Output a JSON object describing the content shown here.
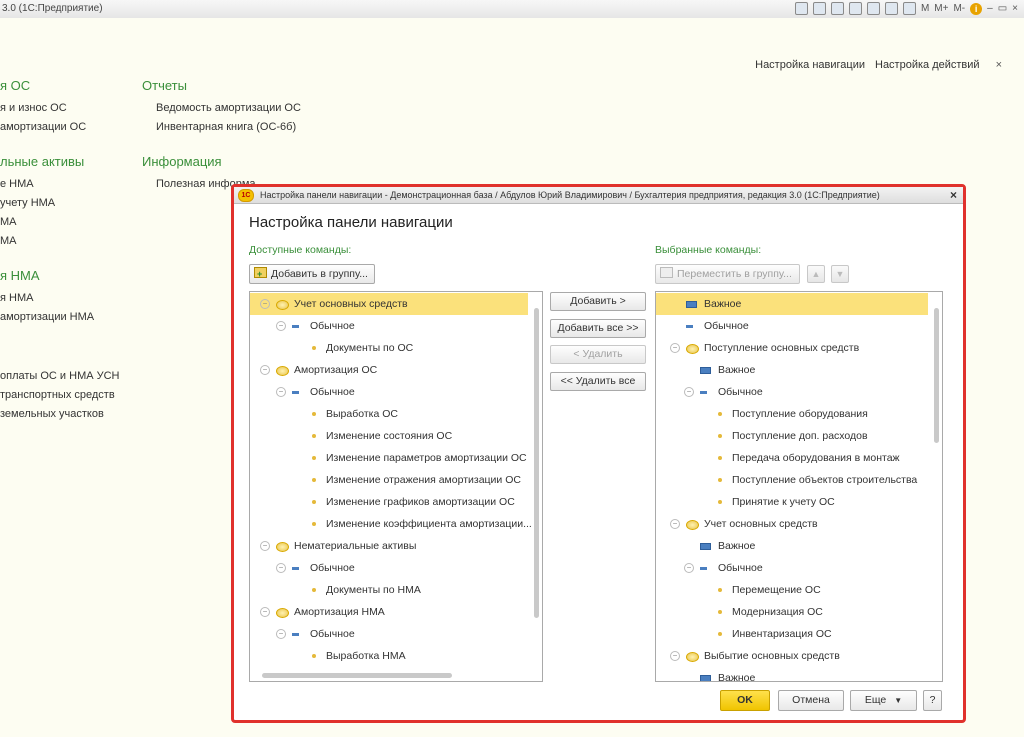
{
  "window": {
    "title": "3.0  (1С:Предприятие)",
    "tools": [
      "M",
      "M+",
      "M-"
    ]
  },
  "nav": {
    "setup_navigation": "Настройка навигации",
    "setup_actions": "Настройка действий",
    "close": "×"
  },
  "left_sections": [
    {
      "title": "я ОС",
      "items": [
        "я и износ ОС",
        "амортизации ОС"
      ]
    },
    {
      "title": "льные активы",
      "items": [
        "е НМА",
        "учету НМА",
        "МА",
        "МА"
      ]
    },
    {
      "title": "я НМА",
      "items": [
        "я НМА",
        "амортизации НМА"
      ]
    },
    {
      "title": "",
      "items": [
        "оплаты ОС и НМА УСН",
        "транспортных средств",
        "земельных участков"
      ]
    }
  ],
  "right_sections": [
    {
      "title": "Отчеты",
      "items": [
        "Ведомость амортизации ОС",
        "Инвентарная книга (ОС-6б)"
      ]
    },
    {
      "title": "Информация",
      "items": [
        "Полезная информа..."
      ]
    }
  ],
  "dialog": {
    "window_title": "Настройка панели навигации - Демонстрационная база / Абдулов Юрий Владимирович / Бухгалтерия предприятия, редакция 3.0  (1С:Предприятие)",
    "logo": "1С",
    "close": "×",
    "heading": "Настройка панели навигации",
    "available_label": "Доступные команды:",
    "selected_label": "Выбранные команды:",
    "add_to_group": "Добавить в группу...",
    "move_to_group": "Переместить в группу...",
    "add": "Добавить >",
    "add_all": "Добавить все >>",
    "remove": "< Удалить",
    "remove_all": "<< Удалить все",
    "ok": "OK",
    "cancel": "Отмена",
    "more": "Еще",
    "help": "?",
    "available_tree": [
      {
        "level": 0,
        "icon": "folder",
        "text": "Учет основных средств",
        "selected": true
      },
      {
        "level": 1,
        "icon": "minus",
        "text": "Обычное"
      },
      {
        "level": 2,
        "icon": "dot",
        "text": "Документы по ОС"
      },
      {
        "level": 0,
        "icon": "folder",
        "text": "Амортизация ОС"
      },
      {
        "level": 1,
        "icon": "minus",
        "text": "Обычное"
      },
      {
        "level": 2,
        "icon": "dot",
        "text": "Выработка ОС"
      },
      {
        "level": 2,
        "icon": "dot",
        "text": "Изменение состояния ОС"
      },
      {
        "level": 2,
        "icon": "dot",
        "text": "Изменение параметров амортизации ОС"
      },
      {
        "level": 2,
        "icon": "dot",
        "text": "Изменение отражения амортизации ОС"
      },
      {
        "level": 2,
        "icon": "dot",
        "text": "Изменение графиков амортизации ОС"
      },
      {
        "level": 2,
        "icon": "dot",
        "text": "Изменение коэффициента амортизации..."
      },
      {
        "level": 0,
        "icon": "folder",
        "text": "Нематериальные активы"
      },
      {
        "level": 1,
        "icon": "minus",
        "text": "Обычное"
      },
      {
        "level": 2,
        "icon": "dot",
        "text": "Документы по НМА"
      },
      {
        "level": 0,
        "icon": "folder",
        "text": "Амортизация НМА"
      },
      {
        "level": 1,
        "icon": "minus",
        "text": "Обычное"
      },
      {
        "level": 2,
        "icon": "dot",
        "text": "Выработка НМА"
      }
    ],
    "selected_tree": [
      {
        "level": 0,
        "icon": "bar",
        "text": "Важное",
        "selected": true,
        "noexp": true
      },
      {
        "level": 0,
        "icon": "minus",
        "text": "Обычное",
        "noexp": true
      },
      {
        "level": 0,
        "icon": "folder",
        "text": "Поступление основных средств"
      },
      {
        "level": 1,
        "icon": "bar",
        "text": "Важное",
        "noexp": true
      },
      {
        "level": 1,
        "icon": "minus",
        "text": "Обычное"
      },
      {
        "level": 2,
        "icon": "dot",
        "text": "Поступление оборудования"
      },
      {
        "level": 2,
        "icon": "dot",
        "text": "Поступление доп. расходов"
      },
      {
        "level": 2,
        "icon": "dot",
        "text": "Передача оборудования в монтаж"
      },
      {
        "level": 2,
        "icon": "dot",
        "text": "Поступление объектов строительства"
      },
      {
        "level": 2,
        "icon": "dot",
        "text": "Принятие к учету ОС"
      },
      {
        "level": 0,
        "icon": "folder",
        "text": "Учет основных средств"
      },
      {
        "level": 1,
        "icon": "bar",
        "text": "Важное",
        "noexp": true
      },
      {
        "level": 1,
        "icon": "minus",
        "text": "Обычное"
      },
      {
        "level": 2,
        "icon": "dot",
        "text": "Перемещение ОС"
      },
      {
        "level": 2,
        "icon": "dot",
        "text": "Модернизация ОС"
      },
      {
        "level": 2,
        "icon": "dot",
        "text": "Инвентаризация ОС"
      },
      {
        "level": 0,
        "icon": "folder",
        "text": "Выбытие основных средств"
      },
      {
        "level": 1,
        "icon": "bar",
        "text": "Важное",
        "noexp": true
      }
    ]
  }
}
